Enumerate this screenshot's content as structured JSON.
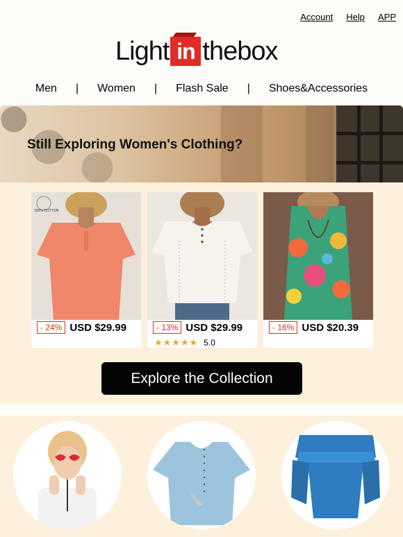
{
  "toplinks": {
    "account": "Account",
    "help": "Help",
    "app": "APP"
  },
  "logo": {
    "part1": "Light",
    "part2": "in",
    "part3": "thebox"
  },
  "nav": {
    "items": [
      "Men",
      "Women",
      "Flash Sale",
      "Shoes&Accessories"
    ],
    "separator": "|"
  },
  "hero": {
    "title": "Still Exploring Women's Clothing?"
  },
  "products": [
    {
      "discount": "- 24%",
      "price": "USD $29.99",
      "badge": "100% COTTON",
      "color": "#f0876a"
    },
    {
      "discount": "- 13%",
      "price": "USD $29.99",
      "rating": "5.0",
      "stars": "★★★★★",
      "color": "#f4f1ea"
    },
    {
      "discount": "- 16%",
      "price": "USD $20.39",
      "color": "#3aa37a"
    }
  ],
  "cta": {
    "label": "Explore the Collection"
  },
  "colors": {
    "accent": "#e02b27",
    "star": "#f5a623",
    "cta_bg": "#050505",
    "section_bg": "#fdf1dd"
  }
}
